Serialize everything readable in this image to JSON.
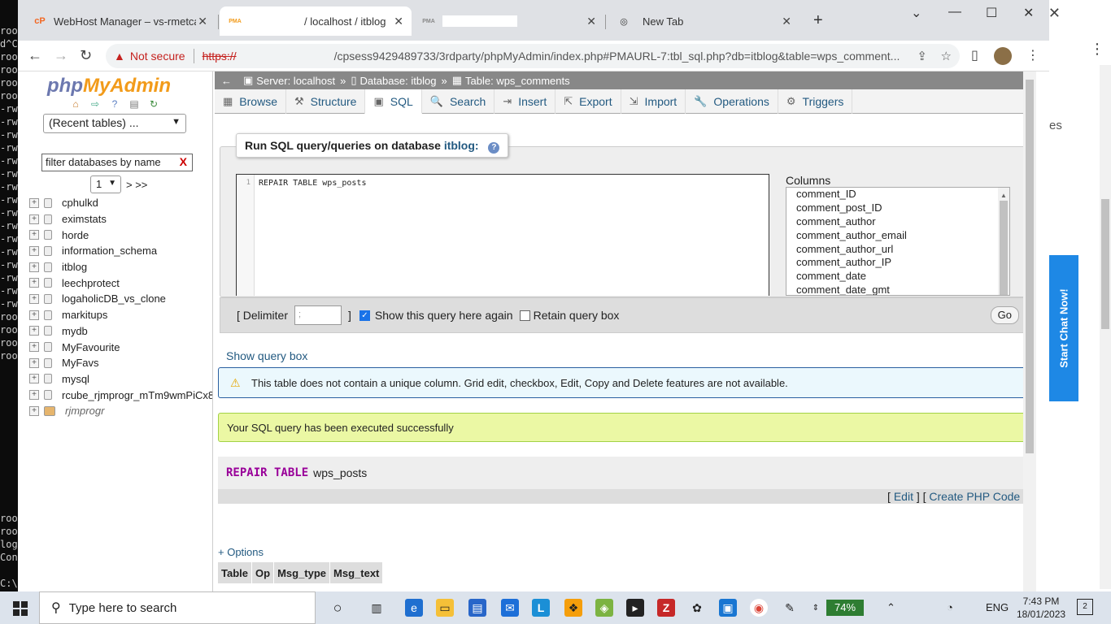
{
  "terminal": {
    "lines": [
      "roo",
      "d^C",
      "roo",
      "roo",
      "roo",
      "roo",
      "-rw",
      "-rw",
      "-rw",
      "-rw",
      "-rw",
      "-rw",
      "-rw",
      "-rw",
      "-rw",
      "-rw",
      "-rw",
      "-rw",
      "-rw",
      "-rw",
      "-rw",
      "-rw",
      "roo",
      "roo",
      "roo",
      "roo"
    ],
    "bottom_lines": [
      "roo",
      "roo",
      "log",
      "Con",
      "",
      "C:\\"
    ]
  },
  "background_window": {
    "close_glyph": "✕",
    "menu_glyph": "⋮",
    "partial_text": "es",
    "chat_label": "Start Chat Now!"
  },
  "tabs": [
    {
      "icon": "cP",
      "label": "WebHost Manager – vs-rmetcalfe",
      "close": "✕"
    },
    {
      "icon": "PMA",
      "label": "/ localhost / itblog",
      "close": "✕"
    },
    {
      "icon": "PMA",
      "label": "",
      "close": "✕"
    },
    {
      "icon": "◎",
      "label": "New Tab",
      "close": "✕"
    }
  ],
  "new_tab_glyph": "+",
  "window_controls": {
    "minimize": "⌄",
    "restore": "—",
    "maximize": "☐",
    "close": "✕"
  },
  "address": {
    "warning": "Not secure",
    "scheme": "https://",
    "path": "/cpsess9429489733/3rdparty/phpMyAdmin/index.php#PMAURL-7:tbl_sql.php?db=itblog&table=wps_comment..."
  },
  "pma": {
    "logo": {
      "php": "php",
      "my": "My",
      "admin": "Admin"
    },
    "recent_tables": "(Recent tables) ...",
    "filter_placeholder": "filter databases by name",
    "filter_clear": "X",
    "page_select": "1",
    "page_next": "> >>",
    "databases": [
      {
        "name": "cphulkd"
      },
      {
        "name": "eximstats"
      },
      {
        "name": "horde"
      },
      {
        "name": "information_schema"
      },
      {
        "name": "itblog"
      },
      {
        "name": "leechprotect"
      },
      {
        "name": "logaholicDB_vs_clone"
      },
      {
        "name": "markitups"
      },
      {
        "name": "mydb"
      },
      {
        "name": "MyFavourite"
      },
      {
        "name": "MyFavs"
      },
      {
        "name": "mysql"
      },
      {
        "name": "rcube_rjmprogr_mTm9wmPiCx8"
      },
      {
        "name": "rjmprogr"
      }
    ],
    "breadcrumb": {
      "back": "←",
      "server": "Server: localhost",
      "database": "Database: itblog",
      "table": "Table: wps_comments",
      "sep": "»",
      "collapse": "⤒"
    },
    "menu": [
      {
        "icon": "▦",
        "label": "Browse"
      },
      {
        "icon": "⚒",
        "label": "Structure"
      },
      {
        "icon": "▣",
        "label": "SQL"
      },
      {
        "icon": "🔍",
        "label": "Search"
      },
      {
        "icon": "⇥",
        "label": "Insert"
      },
      {
        "icon": "⇱",
        "label": "Export"
      },
      {
        "icon": "⇲",
        "label": "Import"
      },
      {
        "icon": "🔧",
        "label": "Operations"
      },
      {
        "icon": "⚙",
        "label": "Triggers"
      }
    ],
    "query_box": {
      "legend_prefix": "Run SQL query/queries on database",
      "legend_db": "itblog:",
      "help": "?",
      "line_number": "1",
      "sql_keyword": "REPAIR TABLE",
      "sql_table": "wps_posts",
      "columns_label": "Columns",
      "columns": [
        "comment_ID",
        "comment_post_ID",
        "comment_author",
        "comment_author_email",
        "comment_author_url",
        "comment_author_IP",
        "comment_date",
        "comment_date_gmt"
      ],
      "delimiter_label_open": "[ Delimiter",
      "delimiter_value": ";",
      "delimiter_label_close": "]",
      "show_again_label": "Show this query here again",
      "show_again_checked": true,
      "retain_label": "Retain query box",
      "retain_checked": false,
      "go": "Go"
    },
    "show_query_box": "Show query box",
    "notice": "This table does not contain a unique column. Grid edit, checkbox, Edit, Copy and Delete features are not available.",
    "success": "Your SQL query has been executed successfully",
    "executed": {
      "keyword": "REPAIR TABLE",
      "table": "wps_posts"
    },
    "links": {
      "edit": "Edit",
      "php": "Create PHP Code"
    },
    "options": "+ Options",
    "result_headers": [
      "Table",
      "Op",
      "Msg_type",
      "Msg_text"
    ]
  },
  "taskbar": {
    "search_placeholder": "Type here to search",
    "battery": "74%",
    "lang": "ENG",
    "time": "7:43 PM",
    "date": "18/01/2023",
    "notifications": "2"
  }
}
